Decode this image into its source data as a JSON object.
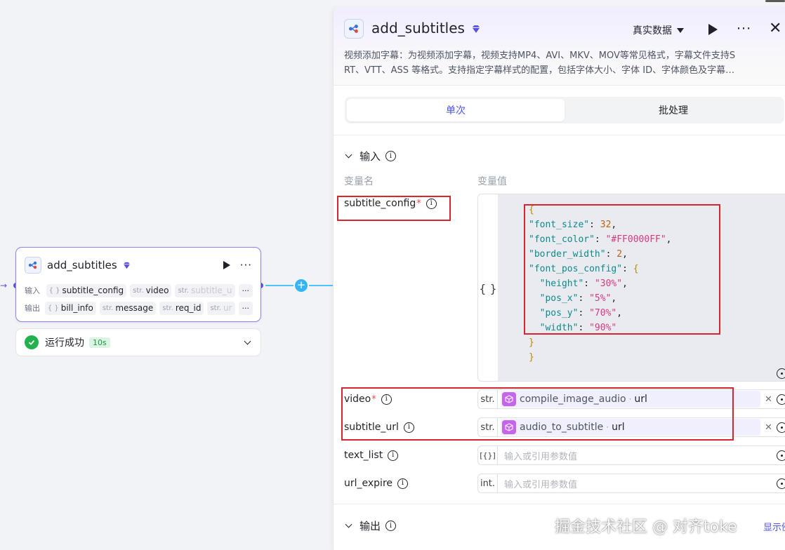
{
  "canvas_node": {
    "title": "add_subtitles",
    "input_label": "输入",
    "output_label": "输出",
    "inputs": [
      {
        "type": "{ }",
        "name": "subtitle_config"
      },
      {
        "type": "str.",
        "name": "video"
      },
      {
        "type": "str.",
        "name": "subtitle_u"
      }
    ],
    "outputs": [
      {
        "type": "{ }",
        "name": "bill_info"
      },
      {
        "type": "str.",
        "name": "message"
      },
      {
        "type": "str.",
        "name": "req_id"
      },
      {
        "type": "str.",
        "name": "ur"
      }
    ],
    "more": "···"
  },
  "run_status": {
    "text": "运行成功",
    "time": "10s"
  },
  "panel": {
    "title": "add_subtitles",
    "mode": "真实数据",
    "description_line1": "视频添加字幕：为视频添加字幕，视频支持MP4、AVI、MKV、MOV等常见格式，字幕文件支持S",
    "description_line2": "RT、VTT、ASS 等格式。支持指定字幕样式的配置，包括字体大小、字体 ID、字体颜色及字幕…",
    "tabs": [
      "单次",
      "批处理"
    ],
    "input_section": "输入",
    "col_name": "变量名",
    "col_value": "变量值",
    "output_section": "输出",
    "show_example": "显示例"
  },
  "vars": {
    "subtitle_config": {
      "name": "subtitle_config",
      "type": "{ }"
    },
    "video": {
      "name": "video",
      "type": "str.",
      "ref_node": "compile_image_audio",
      "ref_var": "url"
    },
    "subtitle_url": {
      "name": "subtitle_url",
      "type": "str.",
      "ref_node": "audio_to_subtitle",
      "ref_var": "url"
    },
    "text_list": {
      "name": "text_list",
      "type": "[{}]",
      "placeholder": "输入或引用参数值"
    },
    "url_expire": {
      "name": "url_expire",
      "type": "int.",
      "placeholder": "输入或引用参数值"
    }
  },
  "json_value": {
    "font_size_key": "\"font_size\"",
    "font_size": "32",
    "font_color_key": "\"font_color\"",
    "font_color": "\"#FF0000FF\"",
    "border_width_key": "\"border_width\"",
    "border_width": "2",
    "font_pos_config_key": "\"font_pos_config\"",
    "height_key": "\"height\"",
    "height": "\"30%\"",
    "pos_x_key": "\"pos_x\"",
    "pos_x": "\"5%\"",
    "pos_y_key": "\"pos_y\"",
    "pos_y": "\"70%\"",
    "width_key": "\"width\"",
    "width": "\"90%\""
  },
  "watermark": "掘金技术社区 @ 对齐toke",
  "colors": {
    "accent": "#4d53e8",
    "success": "#22b14c",
    "highlight": "#d9262e",
    "edge": "#4fc3f7",
    "node_border": "#8d83f0"
  },
  "icons": [
    "plugin-icon",
    "gem-icon",
    "play-icon",
    "more-icon",
    "close-icon",
    "chevron-down-icon",
    "info-icon",
    "check-circle-icon",
    "plus-icon",
    "expand-icon",
    "clear-icon",
    "cube-icon"
  ]
}
